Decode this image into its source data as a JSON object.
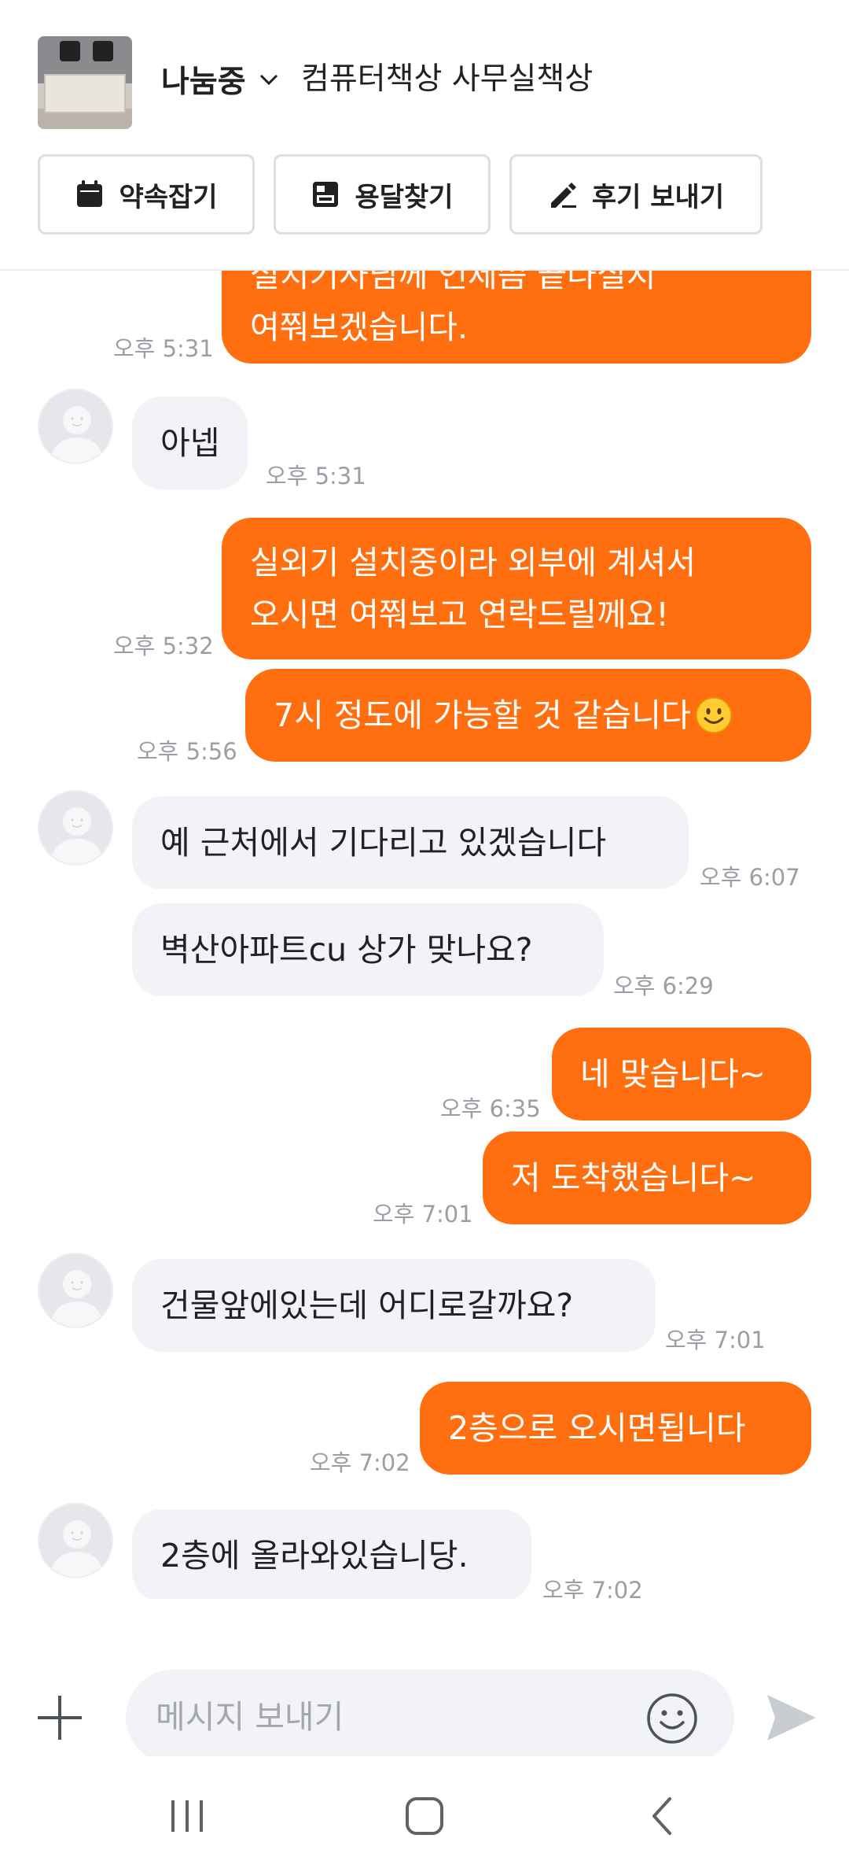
{
  "header": {
    "status": "나눔중",
    "item_title": "컴퓨터책상 사무실책상",
    "buttons": {
      "appointment": "약속잡기",
      "find_delivery": "용달찾기",
      "send_review": "후기 보내기"
    }
  },
  "messages": [
    {
      "side": "mine",
      "lines": [
        "설치기사님께 언제쯤 끝나실지",
        "여쭤보겠습니다."
      ],
      "time": "오후 5:31"
    },
    {
      "side": "theirs",
      "lines": [
        "아넵"
      ],
      "time": "오후 5:31"
    },
    {
      "side": "mine",
      "lines": [
        "실외기 설치중이라 외부에 계셔서",
        "오시면 여쭤보고 연락드릴께요!"
      ],
      "time": "오후 5:32"
    },
    {
      "side": "mine",
      "lines": [
        "7시 정도에 가능할 것 같습니다"
      ],
      "emoji": "smiling-face",
      "time": "오후 5:56"
    },
    {
      "side": "theirs",
      "lines": [
        "예 근처에서 기다리고 있겠습니다"
      ],
      "time": "오후 6:07"
    },
    {
      "side": "theirs",
      "lines": [
        "벽산아파트cu 상가 맞나요?"
      ],
      "time": "오후 6:29"
    },
    {
      "side": "mine",
      "lines": [
        "네 맞습니다~"
      ],
      "time": "오후 6:35"
    },
    {
      "side": "mine",
      "lines": [
        "저 도착했습니다~"
      ],
      "time": "오후 7:01"
    },
    {
      "side": "theirs",
      "lines": [
        "건물앞에있는데 어디로갈까요?"
      ],
      "time": "오후 7:01"
    },
    {
      "side": "mine",
      "lines": [
        "2층으로 오시면됩니다"
      ],
      "time": "오후 7:02"
    },
    {
      "side": "theirs",
      "lines": [
        "2층에 올라와있습니당."
      ],
      "time": "오후 7:02"
    }
  ],
  "composer": {
    "placeholder": "메시지 보내기"
  },
  "colors": {
    "accent": "#ff6f0f",
    "incoming_bubble": "#f2f3f6",
    "timestamp": "#9b9ea5"
  },
  "icons": [
    "calendar-icon",
    "truck-icon",
    "pencil-icon",
    "chevron-down-icon",
    "plus-icon",
    "emoji-icon",
    "send-icon",
    "recent-apps-icon",
    "home-icon",
    "back-icon"
  ]
}
